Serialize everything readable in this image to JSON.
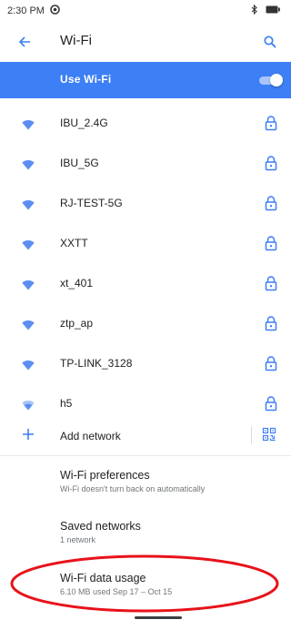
{
  "status_bar": {
    "time": "2:30 PM"
  },
  "header": {
    "title": "Wi-Fi"
  },
  "use_wifi": {
    "label": "Use Wi-Fi",
    "enabled": true
  },
  "networks": [
    {
      "name": "IBU_2.4G",
      "secured": true
    },
    {
      "name": "IBU_5G",
      "secured": true
    },
    {
      "name": "RJ-TEST-5G",
      "secured": true
    },
    {
      "name": "XXTT",
      "secured": true
    },
    {
      "name": "xt_401",
      "secured": true
    },
    {
      "name": "ztp_ap",
      "secured": true
    },
    {
      "name": "TP-LINK_3128",
      "secured": true
    },
    {
      "name": "h5",
      "secured": true
    }
  ],
  "add_network": {
    "label": "Add network"
  },
  "preferences": [
    {
      "title": "Wi-Fi preferences",
      "subtitle": "Wi-Fi doesn't turn back on automatically"
    },
    {
      "title": "Saved networks",
      "subtitle": "1 network"
    },
    {
      "title": "Wi-Fi data usage",
      "subtitle": "6.10 MB used Sep 17 – Oct 15"
    }
  ],
  "colors": {
    "accent": "#3d7ff4",
    "annotation": "#e8121a"
  },
  "icons": {
    "status_app": "app-circle-icon",
    "bluetooth": "bluetooth-icon",
    "battery": "battery-icon",
    "back": "back-arrow-icon",
    "search": "search-icon",
    "wifi": "wifi-signal-icon",
    "lock": "lock-icon",
    "add": "plus-icon",
    "qr": "qr-code-icon"
  }
}
